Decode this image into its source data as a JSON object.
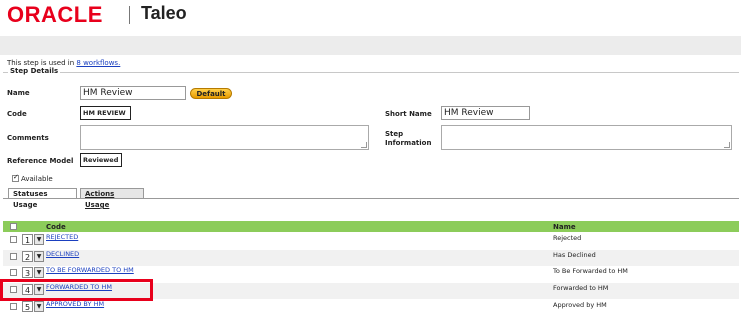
{
  "header": {
    "brand": "ORACLE",
    "product": "Taleo"
  },
  "info": {
    "text": "This step is used in",
    "link": "8 workflows."
  },
  "details": {
    "legend": "Step Details",
    "name_label": "Name",
    "name_value": "HM Review",
    "default_button": "Default",
    "code_label": "Code",
    "code_value": "HM REVIEW",
    "short_name_label": "Short Name",
    "short_name_value": "HM Review",
    "comments_label": "Comments",
    "step_info_label_1": "Step",
    "step_info_label_2": "Information",
    "reference_model_label": "Reference Model",
    "reference_model_value": "Reviewed",
    "available_label": "Available",
    "available_checked": true
  },
  "tabs": [
    {
      "label": "Statuses Usage",
      "active": true
    },
    {
      "label": "Actions Usage",
      "active": false
    }
  ],
  "table": {
    "header_color": "#8ccc5a",
    "columns": {
      "code": "Code",
      "name": "Name"
    },
    "rows": [
      {
        "order": "1",
        "code": "REJECTED",
        "name": "Rejected"
      },
      {
        "order": "2",
        "code": "DECLINED",
        "name": "Has Declined"
      },
      {
        "order": "3",
        "code": "TO BE FORWARDED TO HM",
        "name": "To Be Forwarded to HM"
      },
      {
        "order": "4",
        "code": "FORWARDED TO HM",
        "name": "Forwarded to HM"
      },
      {
        "order": "5",
        "code": "APPROVED BY HM",
        "name": "Approved by HM"
      }
    ]
  },
  "highlight_color": "#e8001c"
}
